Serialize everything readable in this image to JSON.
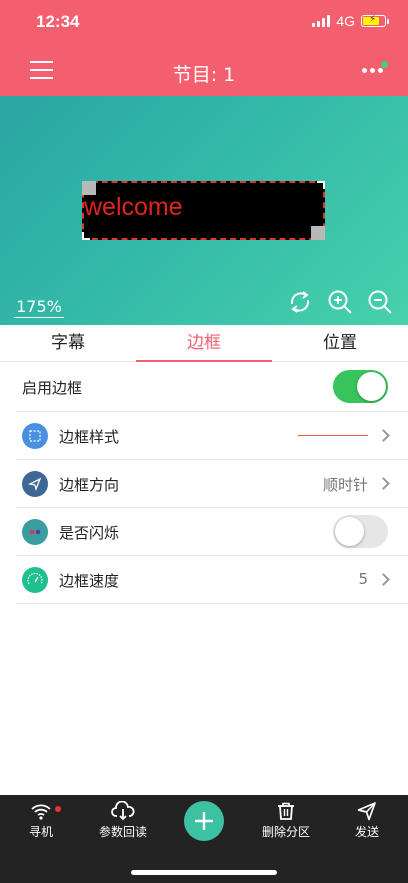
{
  "status_bar": {
    "time": "12:34",
    "network": "4G"
  },
  "header": {
    "title": "节目: 1"
  },
  "preview": {
    "led_text": "welcome",
    "zoom": "175%"
  },
  "tabs": [
    {
      "label": "字幕",
      "active": false
    },
    {
      "label": "边框",
      "active": true
    },
    {
      "label": "位置",
      "active": false
    }
  ],
  "settings": {
    "enable_border": {
      "label": "启用边框",
      "enabled": true
    },
    "border_style": {
      "label": "边框样式"
    },
    "border_direction": {
      "label": "边框方向",
      "value": "顺时针"
    },
    "blink": {
      "label": "是否闪烁",
      "enabled": false
    },
    "border_speed": {
      "label": "边框速度",
      "value": "5"
    }
  },
  "bottom_bar": {
    "find": "寻机",
    "readback": "参数回读",
    "delete_partition": "删除分区",
    "send": "发送"
  },
  "colors": {
    "accent": "#f35f6e",
    "toggle_on": "#37c45c",
    "add_button": "#3dc1a3",
    "led_text": "#e2231a"
  },
  "icons": [
    "menu-icon",
    "more-icon",
    "rotate-icon",
    "zoom-in-icon",
    "zoom-out-icon",
    "wifi-icon",
    "cloud-download-icon",
    "plus-icon",
    "trash-icon",
    "send-icon"
  ]
}
